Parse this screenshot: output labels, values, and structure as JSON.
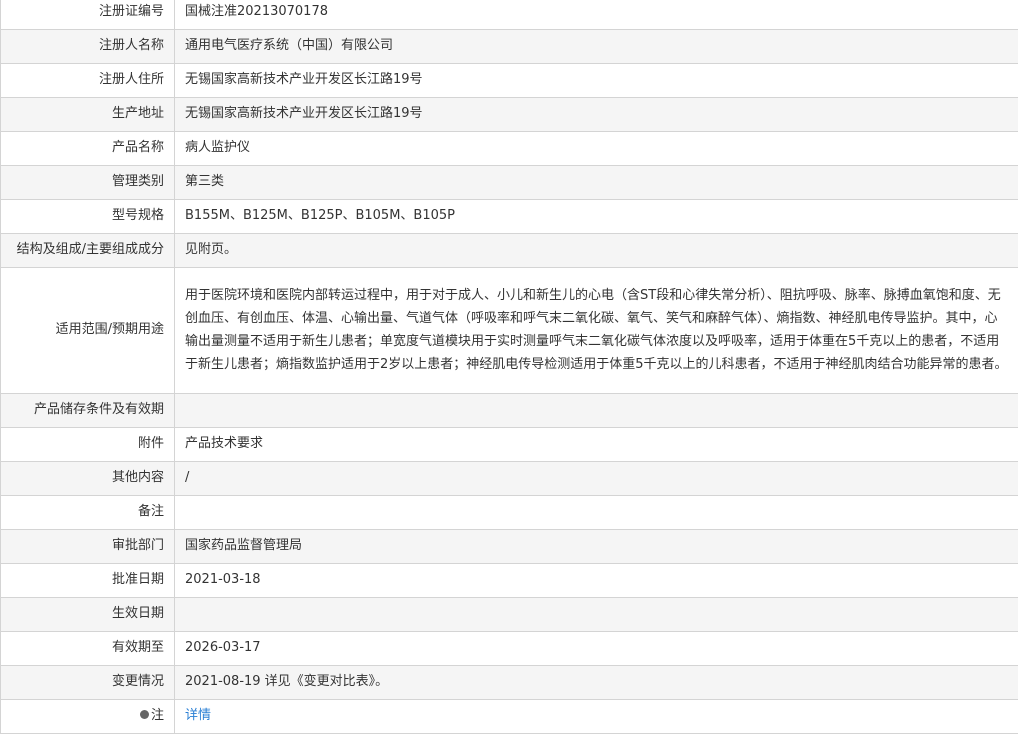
{
  "rows": [
    {
      "label": "注册证编号",
      "value": "国械注准20213070178"
    },
    {
      "label": "注册人名称",
      "value": "通用电气医疗系统（中国）有限公司"
    },
    {
      "label": "注册人住所",
      "value": "无锡国家高新技术产业开发区长江路19号"
    },
    {
      "label": "生产地址",
      "value": "无锡国家高新技术产业开发区长江路19号"
    },
    {
      "label": "产品名称",
      "value": "病人监护仪"
    },
    {
      "label": "管理类别",
      "value": "第三类"
    },
    {
      "label": "型号规格",
      "value": "B155M、B125M、B125P、B105M、B105P"
    },
    {
      "label": "结构及组成/主要组成成分",
      "value": "见附页。"
    },
    {
      "label": "适用范围/预期用途",
      "value": "用于医院环境和医院内部转运过程中，用于对于成人、小儿和新生儿的心电（含ST段和心律失常分析）、阻抗呼吸、脉率、脉搏血氧饱和度、无创血压、有创血压、体温、心输出量、气道气体（呼吸率和呼气末二氧化碳、氧气、笑气和麻醉气体）、熵指数、神经肌电传导监护。其中，心输出量测量不适用于新生儿患者；单宽度气道模块用于实时测量呼气末二氧化碳气体浓度以及呼吸率，适用于体重在5千克以上的患者，不适用于新生儿患者；熵指数监护适用于2岁以上患者；神经肌电传导检测适用于体重5千克以上的儿科患者，不适用于神经肌肉结合功能异常的患者。"
    },
    {
      "label": "产品储存条件及有效期",
      "value": ""
    },
    {
      "label": "附件",
      "value": "产品技术要求"
    },
    {
      "label": "其他内容",
      "value": "/"
    },
    {
      "label": "备注",
      "value": ""
    },
    {
      "label": "审批部门",
      "value": "国家药品监督管理局"
    },
    {
      "label": "批准日期",
      "value": "2021-03-18"
    },
    {
      "label": "生效日期",
      "value": ""
    },
    {
      "label": "有效期至",
      "value": "2026-03-17"
    },
    {
      "label": "变更情况",
      "value": "2021-08-19 详见《变更对比表》。"
    },
    {
      "label": "注",
      "value": "详情",
      "icon": "pin-icon"
    }
  ],
  "colors": {
    "border": "#d4d4d4",
    "stripe": "#f5f5f5",
    "link": "#2a7fd4"
  }
}
